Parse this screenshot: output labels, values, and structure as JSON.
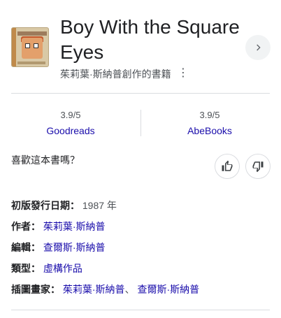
{
  "book": {
    "title": "Boy With the Square Eyes",
    "subtitle": "茱莉葉·斯納普創作的書籍",
    "cover_icon": "book-cover-image"
  },
  "header": {
    "more_icon": "⋮",
    "next_icon": "chevron-right-icon"
  },
  "ratings": [
    {
      "score": "3.9/5",
      "source": "Goodreads"
    },
    {
      "score": "3.9/5",
      "source": "AbeBooks"
    }
  ],
  "feedback": {
    "question": "喜歡這本書嗎？",
    "like_icon": "thumbs-up-icon",
    "dislike_icon": "thumbs-down-icon"
  },
  "facts": {
    "first_published": {
      "label": "初版發行日期：",
      "value": "1987 年"
    },
    "author": {
      "label": "作者：",
      "value": "茱莉葉·斯納普"
    },
    "editor": {
      "label": "編輯：",
      "value": "查爾斯·斯納普"
    },
    "genre": {
      "label": "類型：",
      "value": "虛構作品"
    },
    "illustrators": {
      "label": "插圖畫家：",
      "values": [
        "茱莉葉·斯納普",
        "查爾斯·斯納普"
      ],
      "separator": "、"
    }
  },
  "colors": {
    "link": "#1a0dab",
    "divider": "#dadce0",
    "button_bg": "#f1f3f4"
  }
}
